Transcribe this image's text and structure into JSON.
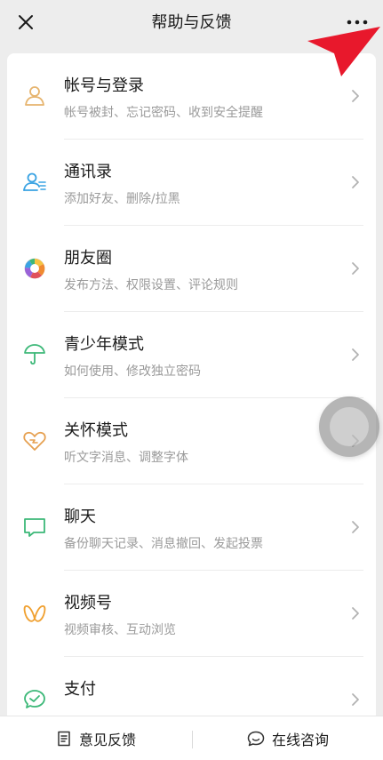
{
  "header": {
    "title": "帮助与反馈"
  },
  "icons": {
    "close": "close-icon",
    "more": "more-icon",
    "arrow_annotation": "red-arrow-pointer"
  },
  "colors": {
    "page_bg": "#ededed",
    "card_bg": "#ffffff",
    "subtitle": "#9a9a9a",
    "annotation_arrow": "#e8182c"
  },
  "items": [
    {
      "title": "帐号与登录",
      "subtitle": "帐号被封、忘记密码、收到安全提醒",
      "icon": "user-icon",
      "icon_color": "#e6b46e"
    },
    {
      "title": "通讯录",
      "subtitle": "添加好友、删除/拉黑",
      "icon": "contacts-icon",
      "icon_color": "#3aa3e3"
    },
    {
      "title": "朋友圈",
      "subtitle": "发布方法、权限设置、评论规则",
      "icon": "moments-icon",
      "icon_color": "#f0a030"
    },
    {
      "title": "青少年模式",
      "subtitle": "如何使用、修改独立密码",
      "icon": "umbrella-icon",
      "icon_color": "#3cb878"
    },
    {
      "title": "关怀模式",
      "subtitle": "听文字消息、调整字体",
      "icon": "care-icon",
      "icon_color": "#e6a050"
    },
    {
      "title": "聊天",
      "subtitle": "备份聊天记录、消息撤回、发起投票",
      "icon": "chat-icon",
      "icon_color": "#3cb878"
    },
    {
      "title": "视频号",
      "subtitle": "视频审核、互动浏览",
      "icon": "channels-icon",
      "icon_color": "#f0a030"
    },
    {
      "title": "支付",
      "subtitle": "",
      "icon": "pay-icon",
      "icon_color": "#3cb878"
    }
  ],
  "bottom": {
    "feedback_label": "意见反馈",
    "consult_label": "在线咨询"
  }
}
